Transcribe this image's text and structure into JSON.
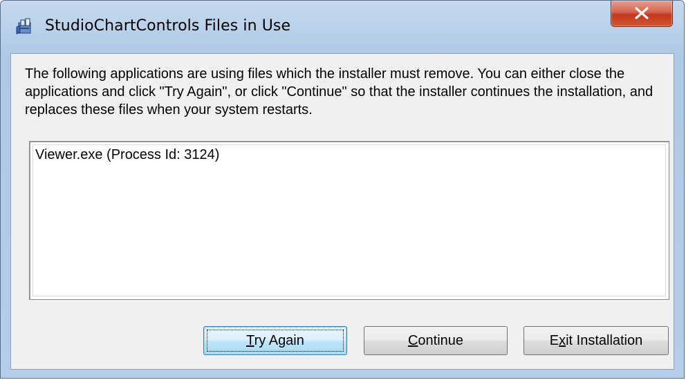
{
  "window": {
    "title": "StudioChartControls Files in Use",
    "icon": "installer-package-icon",
    "close_icon": "close-icon"
  },
  "message": {
    "text": "The following applications are using files which the installer must remove. You can either close the applications and click \"Try Again\", or click \"Continue\" so that the installer continues the installation, and replaces these files when your system restarts."
  },
  "process_list": {
    "items": [
      {
        "label": "Viewer.exe (Process Id: 3124)"
      }
    ]
  },
  "buttons": {
    "try_again": {
      "access_key": "T",
      "rest": "ry Again"
    },
    "continue": {
      "access_key": "C",
      "rest": "ontinue"
    },
    "exit": {
      "pre": "E",
      "access_key": "x",
      "rest": "it Installation"
    }
  },
  "colors": {
    "close_button": "#c3361d",
    "default_button_border": "#3c7fb1"
  }
}
